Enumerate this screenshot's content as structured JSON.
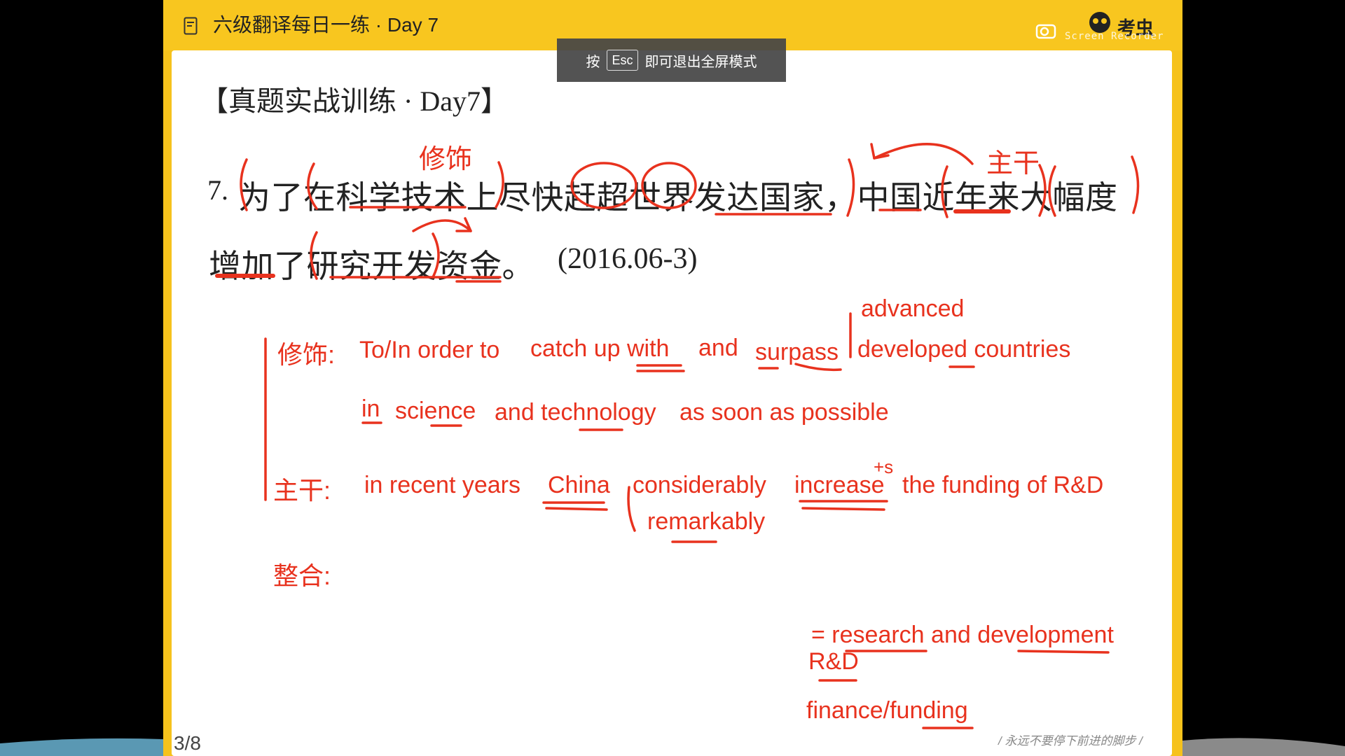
{
  "app": {
    "title": "六级翻译每日一练 · Day 7",
    "recorder_brand": "考虫",
    "recorder_sub": "Screen Recorder"
  },
  "overlay": {
    "esc_prefix": "按",
    "esc_key": "Esc",
    "esc_suffix": "即可退出全屏模式"
  },
  "slide": {
    "heading": "【真题实战训练 · Day7】",
    "question_number": "7.",
    "question_line1": "为了在科学技术上尽快赶超世界发达国家，中国近年来大幅度",
    "question_line2_a": "增加了研究开发资金。",
    "question_line2_b": "(2016.06-3)",
    "page_number": "3/8",
    "slogan": "/ 永远不要停下前进的脚步 /"
  },
  "annotations": {
    "label_modifier": "修饰",
    "label_main": "主干",
    "modifier_prefix": "修饰:",
    "modifier_line1_a": "To/In order to",
    "modifier_line1_b": "catch up with",
    "modifier_line1_c": "and",
    "modifier_line1_d": "surpass",
    "modifier_advanced": "advanced",
    "modifier_line1_e": "developed countries",
    "modifier_line2_a": "in",
    "modifier_line2_b": "science",
    "modifier_line2_c": "and technology",
    "modifier_line2_d": "as soon as possible",
    "main_prefix": "主干:",
    "main_a": "in recent years",
    "main_b": "China",
    "main_c": "considerably",
    "main_plus_s": "+s",
    "main_d": "increase",
    "main_e": "the funding of R&D",
    "main_remarkably": "remarkably",
    "combine_prefix": "整合:",
    "rd_expansion": "= research and development",
    "rd": "R&D",
    "finance": "finance/funding"
  },
  "colors": {
    "frame_yellow": "#f6c21c",
    "ink_red": "#e8321e",
    "text_dark": "#222222"
  }
}
